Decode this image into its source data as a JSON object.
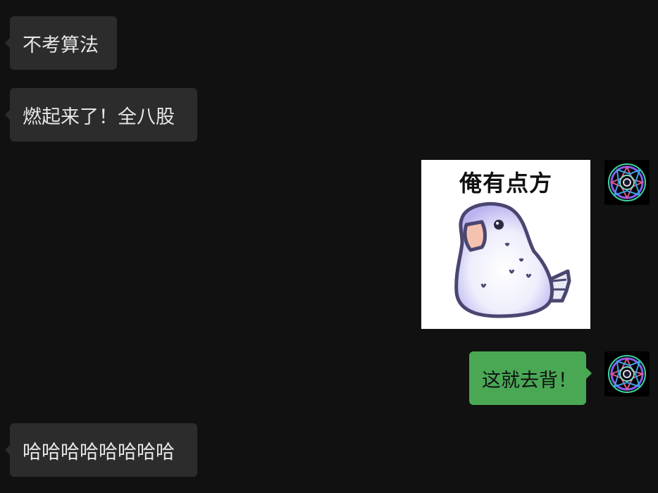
{
  "messages": [
    {
      "side": "in",
      "text": "不考算法"
    },
    {
      "side": "in",
      "text": "燃起来了！全八股"
    },
    {
      "side": "out",
      "type": "sticker",
      "caption": "俺有点方",
      "image": "white-parrot-sticker"
    },
    {
      "side": "out",
      "text": "这就去背！"
    },
    {
      "side": "in",
      "text": "哈哈哈哈哈哈哈哈"
    }
  ],
  "self_avatar": {
    "image": "colorful-spiral-avatar"
  },
  "colors": {
    "background": "#111111",
    "incoming_bubble": "#2c2c2c",
    "outgoing_bubble": "#4aa855"
  }
}
